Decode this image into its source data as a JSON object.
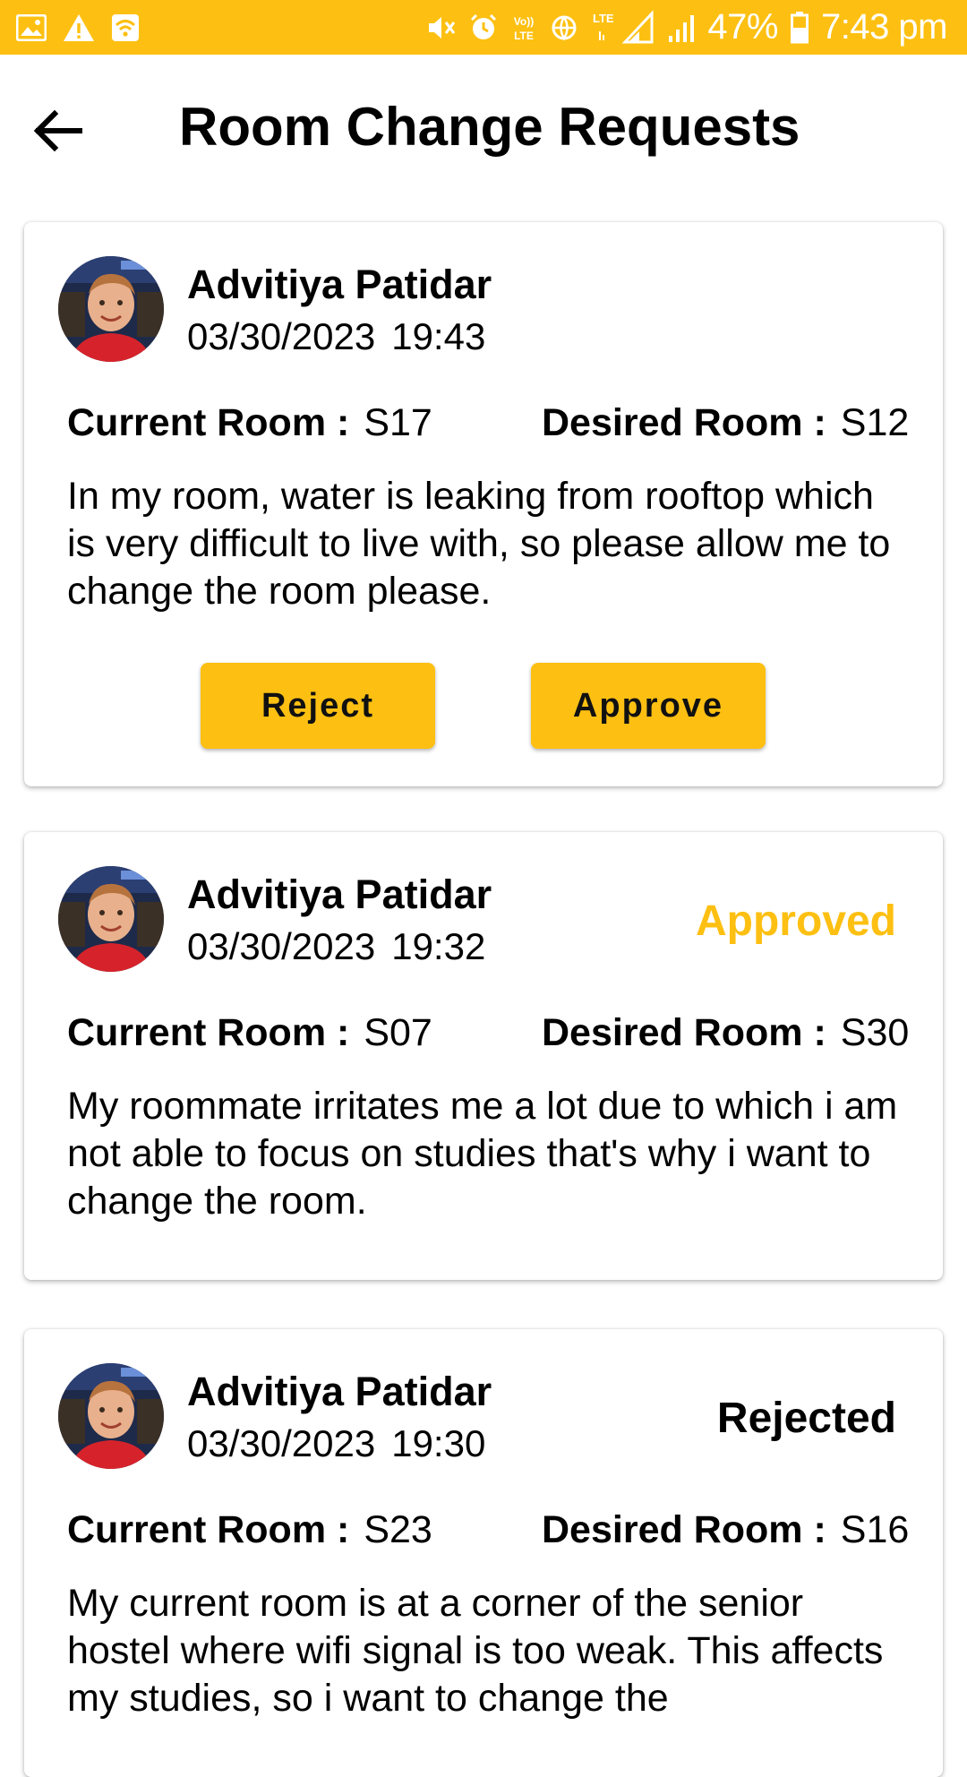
{
  "status_bar": {
    "battery": "47%",
    "time": "7:43 pm",
    "lte_label": "LTE",
    "volte_label": "Vo)) LTE"
  },
  "header": {
    "title": "Room Change Requests"
  },
  "colors": {
    "accent": "#FDC012",
    "approved": "#FDC012",
    "rejected": "#000000"
  },
  "labels": {
    "current_room": "Current Room :",
    "desired_room": "Desired Room :"
  },
  "requests": [
    {
      "name": "Advitiya Patidar",
      "date": "03/30/2023",
      "time": "19:43",
      "status": "",
      "current_room": "S17",
      "desired_room": "S12",
      "reason": "In my room, water is leaking from rooftop which is very difficult to live with, so please allow me to change the room please.",
      "reject_label": "Reject",
      "approve_label": "Approve"
    },
    {
      "name": "Advitiya Patidar",
      "date": "03/30/2023",
      "time": "19:32",
      "status": "Approved",
      "current_room": "S07",
      "desired_room": "S30",
      "reason": "My roommate irritates me a lot due to which i am not able to focus on studies that's why i want to change the room."
    },
    {
      "name": "Advitiya Patidar",
      "date": "03/30/2023",
      "time": "19:30",
      "status": "Rejected",
      "current_room": "S23",
      "desired_room": "S16",
      "reason": "My current room is at a corner of the senior hostel where wifi signal is too weak. This affects my studies, so i want to change the"
    }
  ]
}
